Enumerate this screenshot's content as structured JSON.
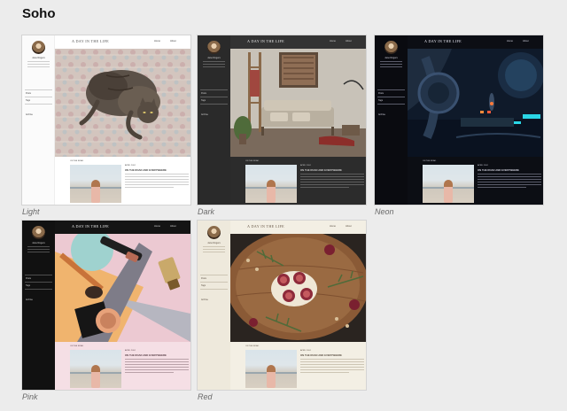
{
  "page": {
    "title": "Soho"
  },
  "preview": {
    "blog_title": "A DAY IN THE LIFE",
    "nav": [
      "Home",
      "About"
    ],
    "author": "Jane Rogers",
    "menu": [
      "Posts",
      "Tags",
      "Archive"
    ],
    "post_meta": "ON THE ROAD",
    "post_date": "APRIL 2024",
    "post_title": "ON THE ROAD AND EVERYWHERE"
  },
  "themes": [
    {
      "name": "Light",
      "hero": "cat-on-quilt",
      "accent": "#ffffff"
    },
    {
      "name": "Dark",
      "hero": "living-room-interior",
      "accent": "#333333"
    },
    {
      "name": "Neon",
      "hero": "sci-fi-spaceship",
      "accent": "#0c0e14"
    },
    {
      "name": "Pink",
      "hero": "cosmetics-flatlay",
      "accent": "#f5dfe5"
    },
    {
      "name": "Red",
      "hero": "figs-cheese-board",
      "accent": "#f3efe4"
    }
  ]
}
